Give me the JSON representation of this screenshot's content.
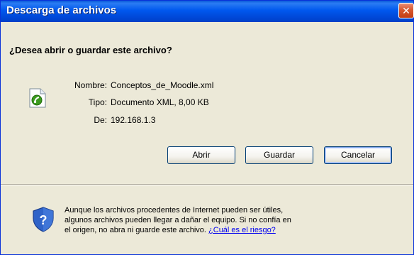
{
  "window": {
    "title": "Descarga de archivos",
    "close_glyph": "✕"
  },
  "dialog": {
    "question": "¿Desea abrir o guardar este archivo?",
    "file_icon": "xml-document-icon",
    "details": {
      "name_label": "Nombre:",
      "name_value": "Conceptos_de_Moodle.xml",
      "type_label": "Tipo:",
      "type_value": "Documento XML, 8,00 KB",
      "from_label": "De:",
      "from_value": "192.168.1.3"
    },
    "buttons": {
      "open_label": "Abrir",
      "save_label": "Guardar",
      "cancel_label": "Cancelar"
    }
  },
  "warning": {
    "icon": "security-shield-question-icon",
    "line1": "Aunque los archivos procedentes de Internet pueden ser útiles,",
    "line2": "algunos archivos pueden llegar a dañar el equipo. Si no confía en",
    "line3_text": "el origen, no abra ni guarde este archivo. ",
    "link_text": "¿Cuál es el riesgo?"
  },
  "colors": {
    "titlebar": "#0058ee",
    "dialog_background": "#ece9d8",
    "close_button": "#d8572e",
    "link": "#0000ee"
  }
}
